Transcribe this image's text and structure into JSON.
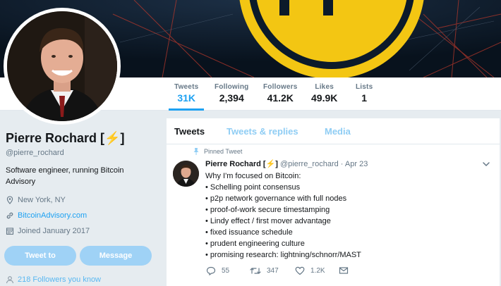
{
  "profile": {
    "name": "Pierre Rochard [",
    "name_suffix": "]",
    "name_emoji": "⚡",
    "handle": "@pierre_rochard",
    "bio": "Software engineer, running Bitcoin Advisory",
    "location": "New York, NY",
    "website": "BitcoinAdvisory.com",
    "joined": "Joined January 2017",
    "tweet_to_label": "Tweet to",
    "message_label": "Message",
    "followers_you_know": "218 Followers you know"
  },
  "stats": [
    {
      "label": "Tweets",
      "value": "31K"
    },
    {
      "label": "Following",
      "value": "2,394"
    },
    {
      "label": "Followers",
      "value": "41.2K"
    },
    {
      "label": "Likes",
      "value": "49.9K"
    },
    {
      "label": "Lists",
      "value": "1"
    }
  ],
  "tabs": [
    {
      "label": "Tweets"
    },
    {
      "label": "Tweets & replies"
    },
    {
      "label": "Media"
    }
  ],
  "tweet": {
    "pinned_label": "Pinned Tweet",
    "author": "Pierre Rochard [⚡]",
    "handle": "@pierre_rochard",
    "date": "· Apr 23",
    "lines": [
      "Why I'm focused on Bitcoin:",
      "• Schelling point consensus",
      "• p2p network governance with full nodes",
      "• proof-of-work secure timestamping",
      "• Lindy effect / first mover advantage",
      "• fixed issuance schedule",
      "• prudent engineering culture",
      "• promising research: lightning/schnorr/MAST"
    ],
    "replies": "55",
    "retweets": "347",
    "likes": "1.2K"
  },
  "colors": {
    "accent": "#1da1f2",
    "button_disabled": "#9fd2f6",
    "banner_bg": "#0b1a2a",
    "banner_coin": "#f3c613",
    "lightning": "#f5a623"
  },
  "icons": [
    "location-icon",
    "link-icon",
    "calendar-icon",
    "pin-icon",
    "chevron-down-icon",
    "reply-icon",
    "retweet-icon",
    "heart-icon",
    "dm-icon",
    "followers-icon"
  ]
}
